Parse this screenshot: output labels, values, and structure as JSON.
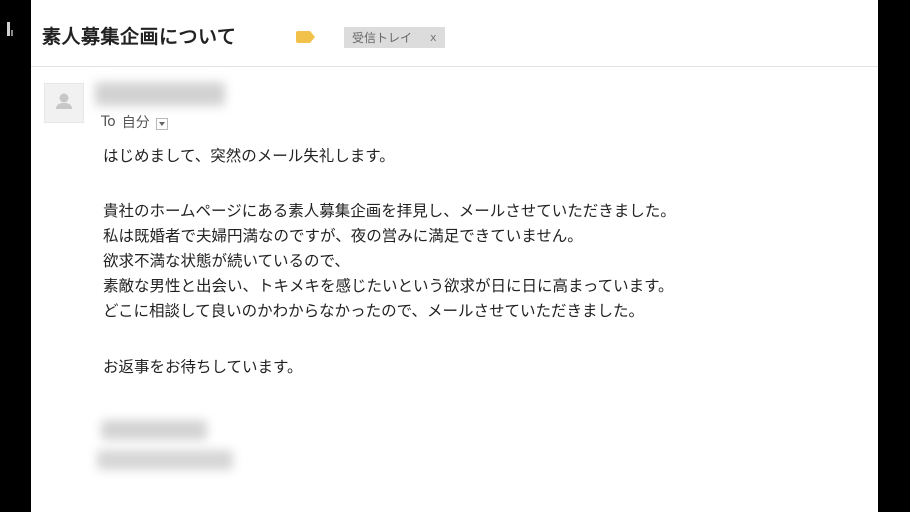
{
  "email": {
    "subject": "素人募集企画について",
    "importance_icon": "importance-marker-icon",
    "label": {
      "name": "受信トレイ",
      "remove": "x"
    },
    "avatar_icon": "person-icon",
    "to_label": "To",
    "recipient": "自分",
    "dropdown_icon": "chevron-down-icon",
    "body": {
      "greeting": "はじめまして、突然のメール失礼します。",
      "paragraph_1": [
        "貴社のホームページにある素人募集企画を拝見し、メールさせていただきました。",
        "私は既婚者で夫婦円満なのですが、夜の営みに満足できていません。",
        "欲求不満な状態が続いているので、",
        "素敵な男性と出会い、トキメキを感じたいという欲求が日に日に高まっています。",
        "どこに相談して良いのかわからなかったので、メールさせていただきました。"
      ],
      "closing": "お返事をお待ちしています。"
    }
  },
  "colors": {
    "importance": "#f2c14a",
    "label_chip": "#dcdcdc",
    "frame": "#000000"
  }
}
